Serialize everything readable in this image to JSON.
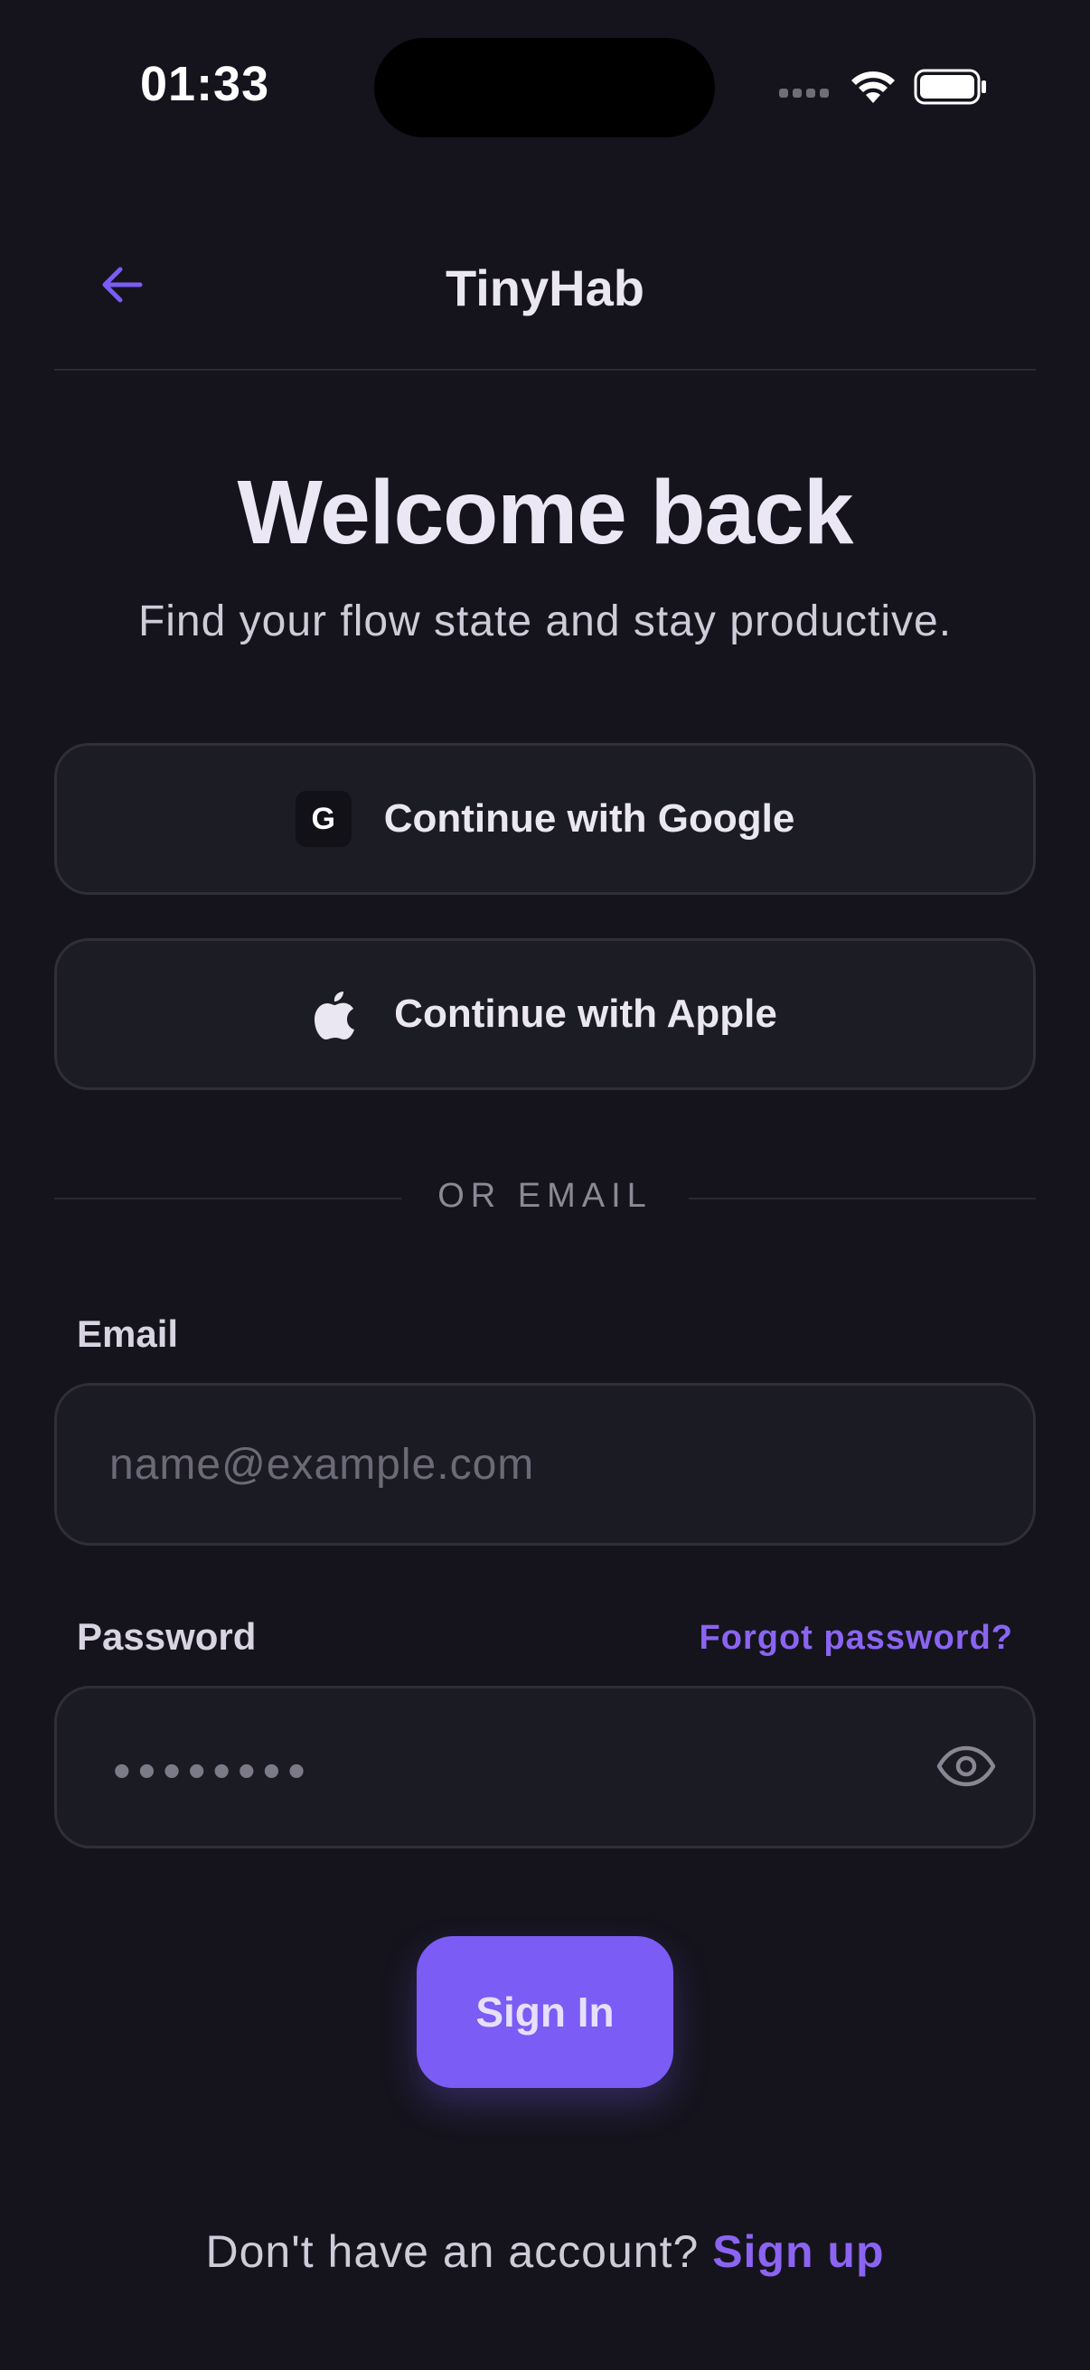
{
  "status_bar": {
    "time": "01:33",
    "icons": [
      "signal-icon",
      "wifi-icon",
      "battery-icon"
    ]
  },
  "header": {
    "back_icon": "arrow-left-icon",
    "title": "TinyHab"
  },
  "hero": {
    "title": "Welcome back",
    "subtitle": "Find your flow state and stay productive."
  },
  "social": {
    "google": {
      "badge": "G",
      "label": "Continue with Google"
    },
    "apple": {
      "icon": "apple-icon",
      "label": "Continue with Apple"
    }
  },
  "divider": {
    "label": "OR EMAIL"
  },
  "form": {
    "email": {
      "label": "Email",
      "placeholder": "name@example.com",
      "value": ""
    },
    "password": {
      "label": "Password",
      "masked_value": "••••••••",
      "forgot_label": "Forgot password?",
      "toggle_icon": "eye-icon"
    },
    "submit_label": "Sign In"
  },
  "footer": {
    "prompt": "Don't have an account?",
    "link_label": "Sign up"
  },
  "colors": {
    "background": "#15141d",
    "accent": "#7b5cf5",
    "link": "#8b64f2",
    "surface": "#1c1c25",
    "border": "#2f2e3a"
  }
}
